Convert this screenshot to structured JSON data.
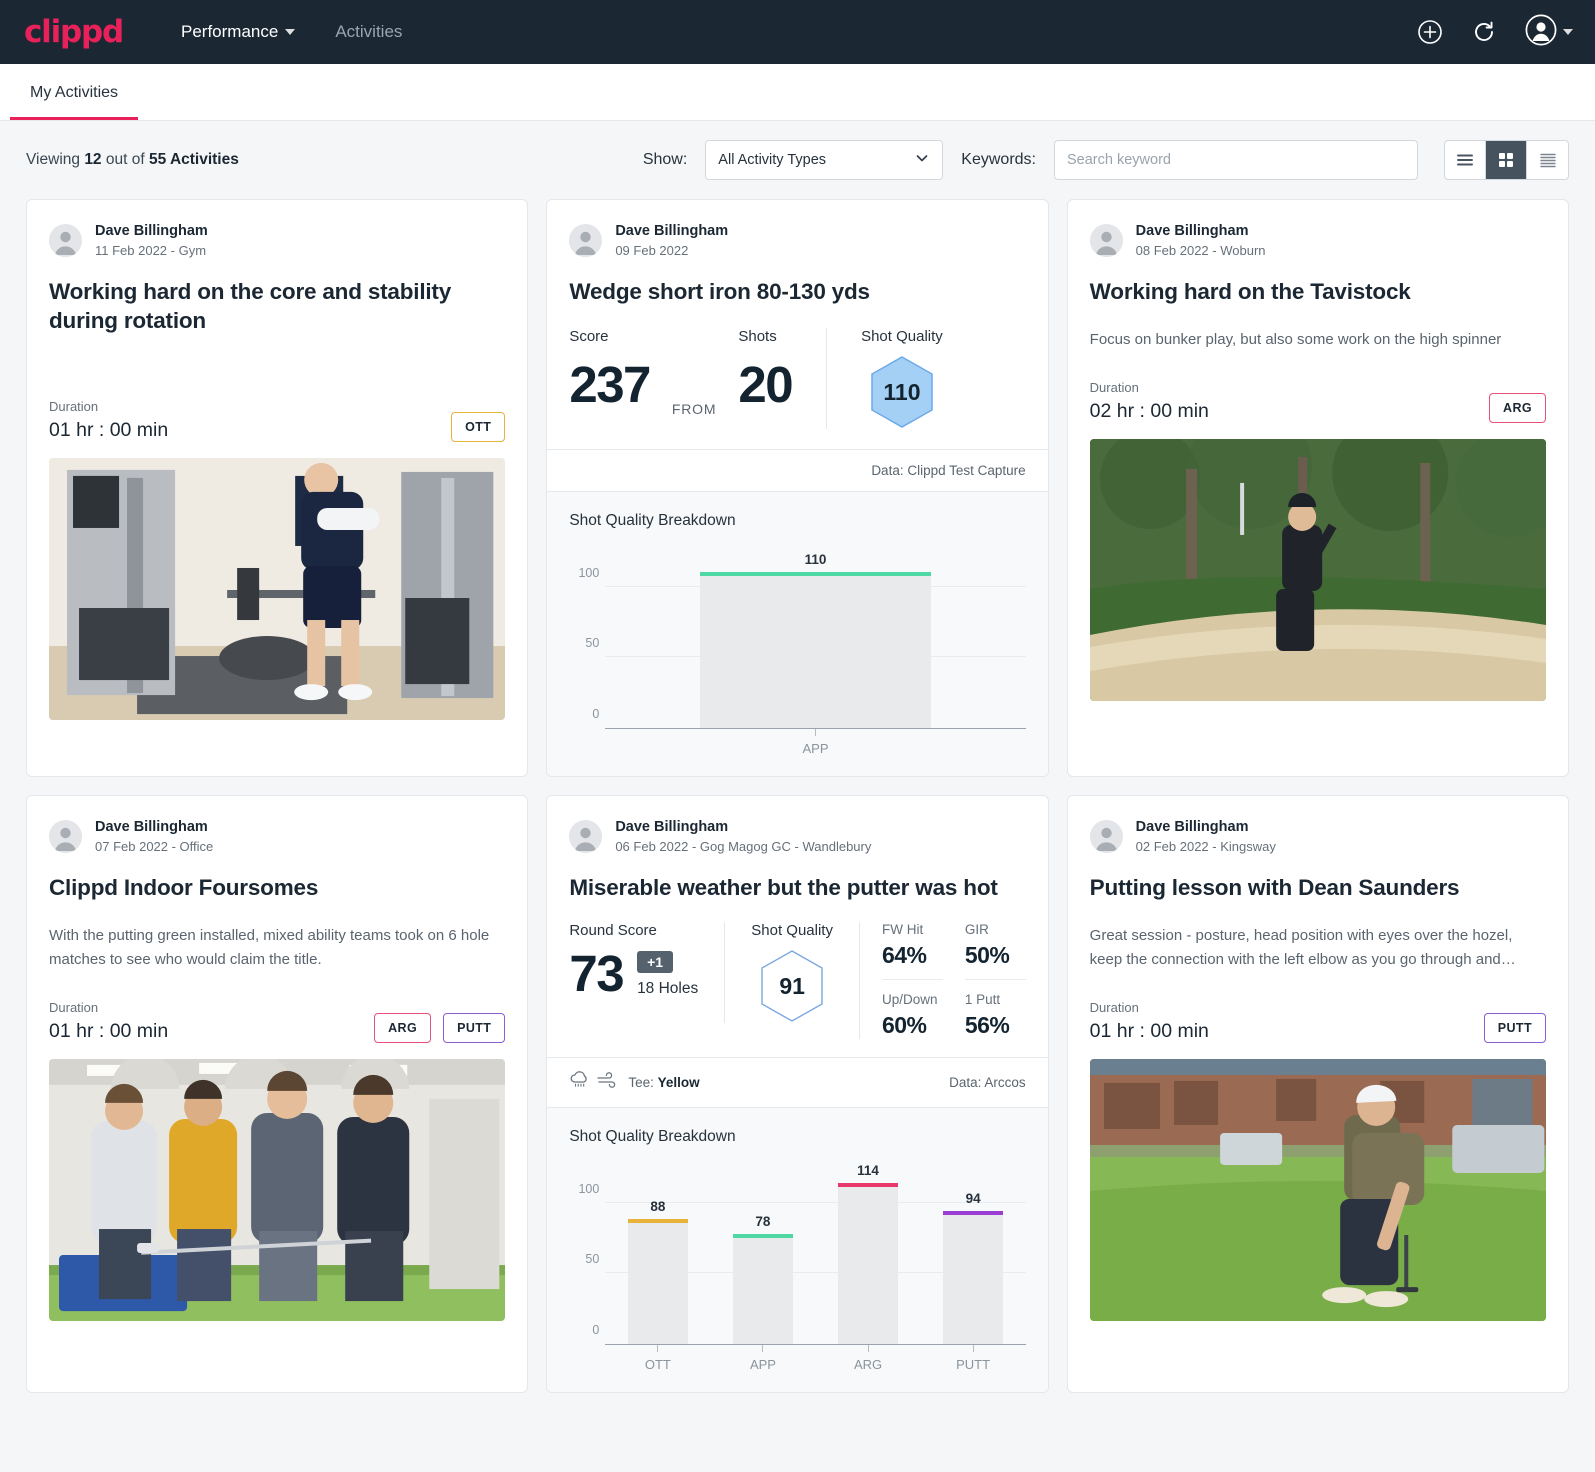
{
  "brand": {
    "logo_text": "clippd",
    "accent": "#e8215a"
  },
  "topnav": {
    "items": [
      {
        "label": "Performance",
        "has_caret": true
      },
      {
        "label": "Activities",
        "has_caret": false
      }
    ],
    "icons": [
      "plus-circle-icon",
      "refresh-icon",
      "account-avatar-icon",
      "chevron-down-icon"
    ]
  },
  "tabs": [
    {
      "label": "My Activities",
      "active": true
    }
  ],
  "filterbar": {
    "viewing_prefix": "Viewing ",
    "viewing_count": "12",
    "viewing_mid": " out of ",
    "viewing_total": "55 Activities",
    "show_label": "Show:",
    "activity_type_value": "All Activity Types",
    "keywords_label": "Keywords:",
    "search_placeholder": "Search keyword",
    "view_modes": [
      "list-view",
      "grid-view",
      "compact-view"
    ],
    "active_view": "grid-view"
  },
  "cards": [
    {
      "author": "Dave Billingham",
      "meta": "11 Feb 2022 - Gym",
      "title": "Working hard on the core and stability during rotation",
      "description": "",
      "duration_label": "Duration",
      "duration_value": "01 hr : 00 min",
      "chips": [
        {
          "label": "OTT",
          "color": "#e8b33a"
        }
      ],
      "photo": "gym-rotation-photo"
    },
    {
      "author": "Dave Billingham",
      "meta": "09 Feb 2022",
      "title": "Wedge short iron 80-130 yds",
      "score_label": "Score",
      "score_value": "237",
      "from_word": "FROM",
      "shots_label": "Shots",
      "shots_value": "20",
      "shot_quality_label": "Shot Quality",
      "shot_quality_value": "110",
      "data_source": "Data: Clippd Test Capture",
      "chart_title": "Shot Quality Breakdown"
    },
    {
      "author": "Dave Billingham",
      "meta": "08 Feb 2022 - Woburn",
      "title": "Working hard on the Tavistock",
      "description": "Focus on bunker play, but also some work on the high spinner",
      "duration_label": "Duration",
      "duration_value": "02 hr : 00 min",
      "chips": [
        {
          "label": "ARG",
          "color": "#e8507a"
        }
      ],
      "photo": "bunker-play-photo"
    },
    {
      "author": "Dave Billingham",
      "meta": "07 Feb 2022 - Office",
      "title": "Clippd Indoor Foursomes",
      "description": "With the putting green installed, mixed ability teams took on 6 hole matches to see who would claim the title.",
      "duration_label": "Duration",
      "duration_value": "01 hr : 00 min",
      "chips": [
        {
          "label": "ARG",
          "color": "#e8507a"
        },
        {
          "label": "PUTT",
          "color": "#8a5fd0"
        }
      ],
      "photo": "indoor-foursomes-photo"
    },
    {
      "author": "Dave Billingham",
      "meta": "06 Feb 2022 - Gog Magog GC - Wandlebury",
      "title": "Miserable weather but the putter was hot",
      "round_score_label": "Round Score",
      "round_score_value": "73",
      "round_score_badge": "+1",
      "holes_text": "18 Holes",
      "shot_quality_label": "Shot Quality",
      "shot_quality_value": "91",
      "mini_stats": [
        {
          "label": "FW Hit",
          "value": "64%"
        },
        {
          "label": "GIR",
          "value": "50%"
        },
        {
          "label": "Up/Down",
          "value": "60%"
        },
        {
          "label": "1 Putt",
          "value": "56%"
        }
      ],
      "tee_prefix": "Tee: ",
      "tee_value": "Yellow",
      "weather_icons": [
        "rain-cloud-icon",
        "wind-icon"
      ],
      "data_source": "Data: Arccos",
      "chart_title": "Shot Quality Breakdown"
    },
    {
      "author": "Dave Billingham",
      "meta": "02 Feb 2022 - Kingsway",
      "title": "Putting lesson with Dean Saunders",
      "description": "Great session - posture, head position with eyes over the hozel, keep the connection with the left elbow as you go through and…",
      "duration_label": "Duration",
      "duration_value": "01 hr : 00 min",
      "chips": [
        {
          "label": "PUTT",
          "color": "#8a5fd0"
        }
      ],
      "photo": "putting-lesson-photo"
    }
  ],
  "chart_data": [
    {
      "type": "bar",
      "title": "Shot Quality Breakdown",
      "categories": [
        "APP"
      ],
      "values": [
        110
      ],
      "bar_colors": [
        "#4ed8a4"
      ],
      "yticks": [
        0,
        50,
        100
      ],
      "ylim": [
        0,
        130
      ],
      "xlabel": "",
      "ylabel": "",
      "grid": true,
      "legend": "none"
    },
    {
      "type": "bar",
      "title": "Shot Quality Breakdown",
      "categories": [
        "OTT",
        "APP",
        "ARG",
        "PUTT"
      ],
      "values": [
        88,
        78,
        114,
        94
      ],
      "bar_colors": [
        "#e8b33a",
        "#4ed8a4",
        "#e8386b",
        "#9b3fd4"
      ],
      "yticks": [
        0,
        50,
        100
      ],
      "ylim": [
        0,
        130
      ],
      "xlabel": "",
      "ylabel": "",
      "grid": true,
      "legend": "none"
    }
  ]
}
